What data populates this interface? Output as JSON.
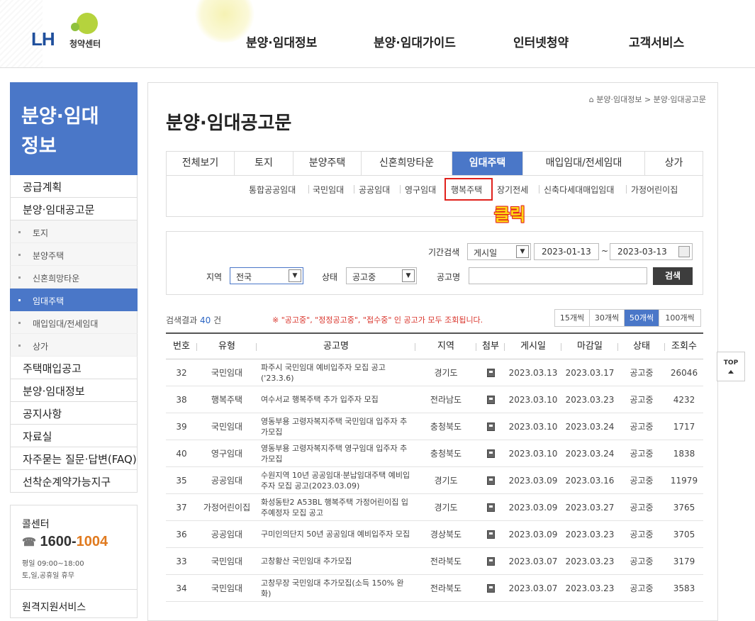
{
  "header": {
    "logo_text": "LH",
    "logo_sub": "청약센터",
    "nav": [
      "분양·임대정보",
      "분양·임대가이드",
      "인터넷청약",
      "고객서비스"
    ]
  },
  "sidebar": {
    "title_line1": "분양·임대",
    "title_line2": "정보",
    "items_top": [
      "공급계획",
      "분양·임대공고문"
    ],
    "sub_items": [
      "토지",
      "분양주택",
      "신혼희망타운",
      "임대주택",
      "매입임대/전세임대",
      "상가"
    ],
    "active_sub": "임대주택",
    "items_bottom": [
      "주택매입공고",
      "분양·임대정보",
      "공지사항",
      "자료실",
      "자주묻는 질문·답변(FAQ)",
      "선착순계약가능지구"
    ],
    "call": {
      "title": "콜센터",
      "num_a": "1600-",
      "num_b": "1004",
      "hours1": "평일 09:00~18:00",
      "hours2": "토,일,공휴일 휴무",
      "remote": "원격지원서비스"
    }
  },
  "main": {
    "breadcrumb": "분양·임대정보 > 분양·임대공고문",
    "page_title": "분양·임대공고문",
    "tabs": [
      "전체보기",
      "토지",
      "분양주택",
      "신혼희망타운",
      "임대주택",
      "매입임대/전세임대",
      "상가"
    ],
    "active_tab": "임대주택",
    "subtabs": [
      "통합공공임대",
      "국민임대",
      "공공임대",
      "영구임대",
      "행복주택",
      "장기전세",
      "신축다세대매입임대",
      "가정어린이집"
    ],
    "highlight_subtab": "행복주택",
    "click_annotation": "클릭",
    "search": {
      "period_label": "기간검색",
      "period_type": "게시일",
      "date_from": "2023-01-13",
      "tilde": "~",
      "date_to": "2023-03-13",
      "region_label": "지역",
      "region_value": "전국",
      "status_label": "상태",
      "status_value": "공고중",
      "name_label": "공고명",
      "name_value": "",
      "button": "검색"
    },
    "result_prefix": "검색결과",
    "result_count": "40",
    "result_suffix": "건",
    "notice": "※ \"공고중\", \"정정공고중\", \"접수중\" 인 공고가 모두 조회됩니다.",
    "page_sizes": [
      "15개씩",
      "30개씩",
      "50개씩",
      "100개씩"
    ],
    "page_size_active": "50개씩",
    "table": {
      "headers": [
        "번호",
        "유형",
        "공고명",
        "지역",
        "첨부",
        "게시일",
        "마감일",
        "상태",
        "조회수"
      ],
      "rows": [
        {
          "no": "32",
          "type": "국민임대",
          "title": "파주시 국민임대 예비입주자 모집 공고('23.3.6)",
          "region": "경기도",
          "posted": "2023.03.13",
          "due": "2023.03.17",
          "status": "공고중",
          "views": "26046"
        },
        {
          "no": "38",
          "type": "행복주택",
          "title": "여수서교 행복주택 추가 입주자 모집",
          "region": "전라남도",
          "posted": "2023.03.10",
          "due": "2023.03.23",
          "status": "공고중",
          "views": "4232"
        },
        {
          "no": "39",
          "type": "국민임대",
          "title": "영동부용 고령자복지주택 국민임대 입주자 추가모집",
          "region": "충청북도",
          "posted": "2023.03.10",
          "due": "2023.03.24",
          "status": "공고중",
          "views": "1717"
        },
        {
          "no": "40",
          "type": "영구임대",
          "title": "영동부용 고령자복지주택 영구임대 입주자 추가모집",
          "region": "충청북도",
          "posted": "2023.03.10",
          "due": "2023.03.24",
          "status": "공고중",
          "views": "1838"
        },
        {
          "no": "35",
          "type": "공공임대",
          "title": "수원지역 10년 공공임대·분납임대주택 예비입주자 모집 공고(2023.03.09)",
          "region": "경기도",
          "posted": "2023.03.09",
          "due": "2023.03.16",
          "status": "공고중",
          "views": "11979"
        },
        {
          "no": "37",
          "type": "가정어린이집",
          "title": "화성동탄2 A53BL 행복주택 가정어린이집 입주예정자 모집 공고",
          "region": "경기도",
          "posted": "2023.03.09",
          "due": "2023.03.27",
          "status": "공고중",
          "views": "3765"
        },
        {
          "no": "36",
          "type": "공공임대",
          "title": "구미인의단지 50년 공공임대 예비입주자 모집",
          "region": "경상북도",
          "posted": "2023.03.09",
          "due": "2023.03.23",
          "status": "공고중",
          "views": "3705"
        },
        {
          "no": "33",
          "type": "국민임대",
          "title": "고창황산 국민임대 추가모집",
          "region": "전라북도",
          "posted": "2023.03.07",
          "due": "2023.03.23",
          "status": "공고중",
          "views": "3179"
        },
        {
          "no": "34",
          "type": "국민임대",
          "title": "고창무장 국민임대 추가모집(소득 150% 완화)",
          "region": "전라북도",
          "posted": "2023.03.07",
          "due": "2023.03.23",
          "status": "공고중",
          "views": "3583"
        }
      ]
    }
  },
  "top_button": "TOP",
  "colors": {
    "accent": "#4a77c8",
    "highlight": "#e0211c",
    "click_text": "#ffd814"
  }
}
